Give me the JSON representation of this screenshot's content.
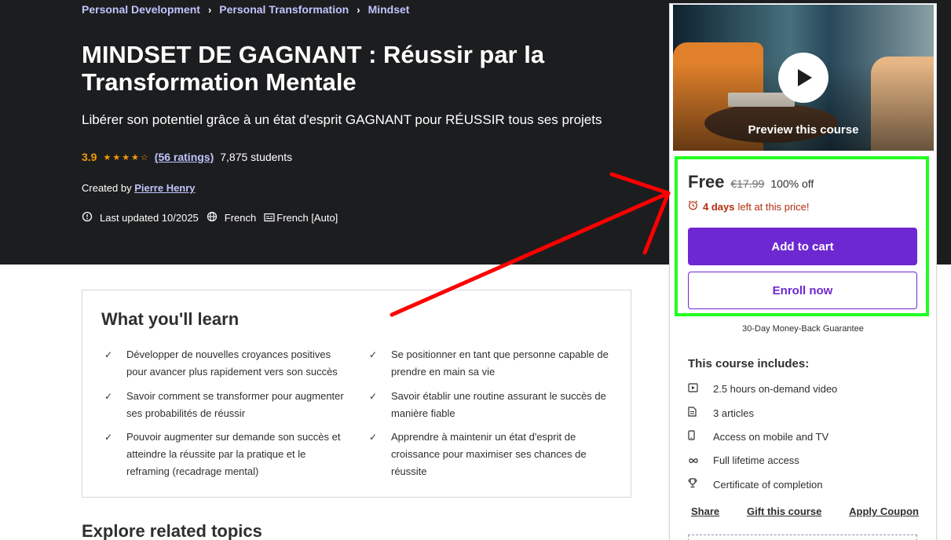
{
  "breadcrumb": [
    "Personal Development",
    "Personal Transformation",
    "Mindset"
  ],
  "course": {
    "title": "MINDSET DE GAGNANT : Réussir par la Transformation Mentale",
    "subtitle": "Libérer son potentiel grâce à un état d'esprit GAGNANT pour RÉUSSIR tous ses projets",
    "rating": "3.9",
    "rating_stars": 3.9,
    "ratings_count": "(56 ratings)",
    "students": "7,875 students",
    "created_by_label": "Created by",
    "author": "Pierre Henry",
    "last_updated": "Last updated 10/2025",
    "language": "French",
    "captions": "French [Auto]"
  },
  "learn": {
    "title": "What you'll learn",
    "items": [
      "Développer de nouvelles croyances positives pour avancer plus rapidement vers son succès",
      "Se positionner en tant que personne capable de prendre en main sa vie",
      "Savoir comment se transformer pour augmenter ses probabilités de réussir",
      "Savoir établir une routine assurant le succès de manière fiable",
      "Pouvoir augmenter sur demande son succès et atteindre la réussite par la pratique et le reframing (recadrage mental)",
      "Apprendre à maintenir un état d'esprit de croissance pour maximiser ses chances de réussite"
    ]
  },
  "explore_title": "Explore related topics",
  "card": {
    "preview_label": "Preview this course",
    "price": "Free",
    "original_price": "€17.99",
    "discount": "100% off",
    "timer_days": "4 days",
    "timer_text": "left at this price!",
    "add_to_cart": "Add to cart",
    "enroll_now": "Enroll now",
    "guarantee": "30-Day Money-Back Guarantee",
    "includes_title": "This course includes:",
    "includes": [
      {
        "icon": "video-icon",
        "label": "2.5 hours on-demand video"
      },
      {
        "icon": "article-icon",
        "label": "3 articles"
      },
      {
        "icon": "mobile-icon",
        "label": "Access on mobile and TV"
      },
      {
        "icon": "infinity-icon",
        "label": "Full lifetime access"
      },
      {
        "icon": "trophy-icon",
        "label": "Certificate of completion"
      }
    ],
    "links": [
      "Share",
      "Gift this course",
      "Apply Coupon"
    ]
  },
  "colors": {
    "hero_bg": "#1c1d1f",
    "accent_purple": "#6d28d2",
    "link_lavender": "#c0c4fc",
    "star_orange": "#f69c08",
    "annotation_green": "#22ff22",
    "annotation_red": "#ff0000"
  }
}
